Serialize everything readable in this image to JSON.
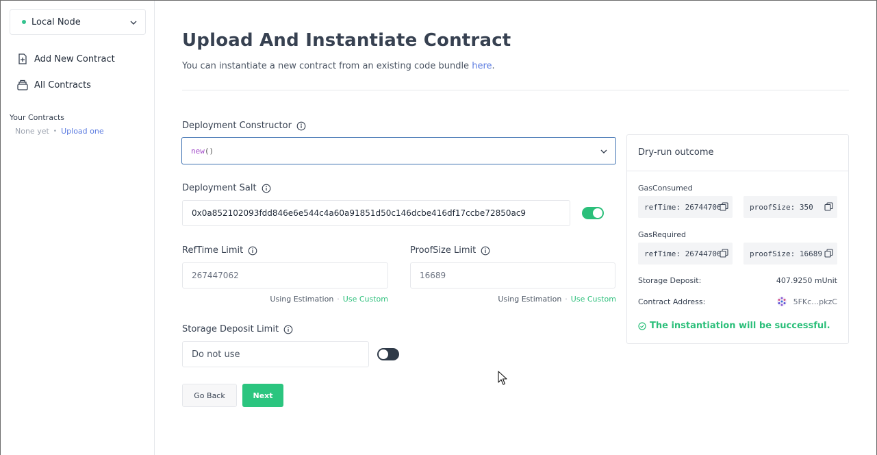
{
  "sidebar": {
    "network": "Local Node",
    "nav": [
      {
        "label": "Add New Contract",
        "icon": "file-plus-icon"
      },
      {
        "label": "All Contracts",
        "icon": "archive-icon"
      }
    ],
    "your_contracts_heading": "Your Contracts",
    "none_yet": "None yet",
    "upload_one": "Upload one"
  },
  "main": {
    "title": "Upload And Instantiate Contract",
    "subtitle": "You can instantiate a new contract from an existing code bundle",
    "subtitle_link": "here",
    "constructor": {
      "label": "Deployment Constructor",
      "fn_name": "new",
      "fn_args": "()"
    },
    "salt": {
      "label": "Deployment Salt",
      "value": "0x0a852102093fdd846e6e544c4a60a91851d50c146dcbe416df17ccbe72850ac9",
      "enabled": true
    },
    "reftime": {
      "label": "RefTime Limit",
      "placeholder": "267447062",
      "estimation": "Using Estimation",
      "custom": "Use Custom"
    },
    "proofsize": {
      "label": "ProofSize Limit",
      "placeholder": "16689",
      "estimation": "Using Estimation",
      "custom": "Use Custom"
    },
    "storage": {
      "label": "Storage Deposit Limit",
      "placeholder": "Do not use",
      "enabled": false
    },
    "buttons": {
      "back": "Go Back",
      "next": "Next"
    }
  },
  "dryrun": {
    "title": "Dry-run outcome",
    "gas_consumed_label": "GasConsumed",
    "gas_consumed": {
      "reftime": "refTime: 267447062",
      "proofsize": "proofSize: 350"
    },
    "gas_required_label": "GasRequired",
    "gas_required": {
      "reftime": "refTime: 267447062",
      "proofsize": "proofSize: 16689"
    },
    "storage_deposit_label": "Storage Deposit:",
    "storage_deposit_value": "407.9250 mUnit",
    "contract_address_label": "Contract Address:",
    "contract_address_value": "5FKc…pkzC",
    "success_message": "The instantiation will be successful."
  },
  "colors": {
    "accent_green": "#2bbf7a",
    "link_blue": "#5b7be0",
    "focus_border": "#3b6fb0"
  }
}
